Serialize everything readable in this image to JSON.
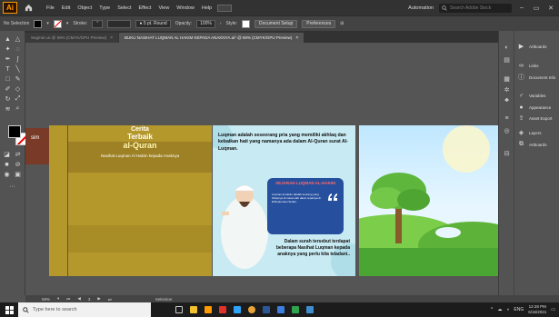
{
  "app": {
    "logo_text": "Ai"
  },
  "menu": [
    "File",
    "Edit",
    "Object",
    "Type",
    "Select",
    "Effect",
    "View",
    "Window",
    "Help"
  ],
  "header_right": {
    "workspace": "Automation",
    "search_placeholder": "Search Adobe Stock"
  },
  "controlbar": {
    "selection": "No Selection",
    "stroke_label": "Stroke:",
    "brush": "5 pt. Round",
    "opacity_label": "Opacity:",
    "opacity_value": "100%",
    "style_label": "Style:",
    "doc_setup": "Document Setup",
    "preferences": "Preferences"
  },
  "tabs": [
    {
      "label": "Segmen.ai @ 59% (CMYK/GPU Preview)",
      "active": false,
      "close": "×"
    },
    {
      "label": "BUKU NASIHAT LUQMAN AL HAKIM KEPADA ANAKNYA.ai* @ 59% (CMYK/GPU Preview)",
      "active": true,
      "close": "×"
    }
  ],
  "board2": {
    "cerita": "Cerita",
    "terbaik": "Terbaik",
    "alquran": "al-Quran",
    "subtitle": "Nasihat Luqman Al Hakim kepada Anaknya"
  },
  "board3": {
    "intro": "Luqman adalah seseorang pria yang memiliki akhlaq dan kebaikan hati yang namanya ada dalam Al-Quran surat Al-Luqman.",
    "card_title": "SEJARAH LUQMAN AL-HAKIM",
    "card_body": "Luqman al-hakim adalah seorang yang hidupnya di masa nabi daud, tepatnya di Ethiopia atau Sudan.",
    "bottom": "Dalam surah tersebut terdapat beberapa Nasihat Luqman kepada anaknya yang perlu kita teladani.."
  },
  "left_snippet": "sim",
  "right_panels": [
    "Artboards",
    "Links",
    "Document Info",
    "Variables",
    "Appearance",
    "Asset Export",
    "Layers",
    "Artboards"
  ],
  "statusbar": {
    "zoom": "59%",
    "page": "3",
    "tool": "Selection"
  },
  "taskbar": {
    "search_placeholder": "Type here to search",
    "time": "12:28 PM",
    "date": "6/16/2021"
  },
  "colors": {
    "menubar": "#323232",
    "ui_gray": "#535353",
    "board_gold": "#b5982c",
    "card_blue": "#264f9e",
    "ai_orange": "#ff9a00"
  }
}
